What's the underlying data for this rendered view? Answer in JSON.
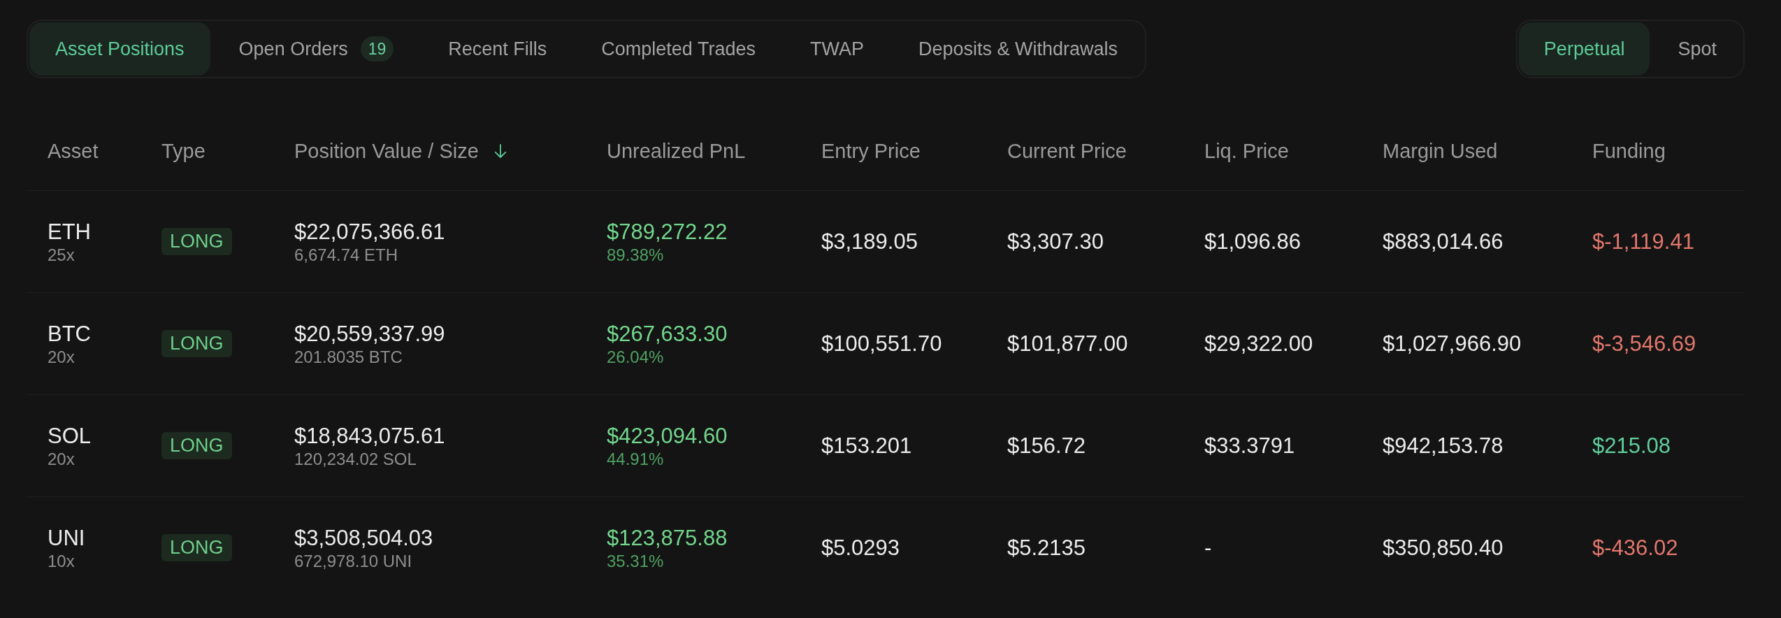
{
  "position_tabs": [
    {
      "label": "Asset Positions",
      "selected": true
    },
    {
      "label": "Open Orders",
      "count": "19",
      "selected": false
    },
    {
      "label": "Recent Fills",
      "selected": false
    },
    {
      "label": "Completed Trades",
      "selected": false
    },
    {
      "label": "TWAP",
      "selected": false
    },
    {
      "label": "Deposits & Withdrawals",
      "selected": false
    }
  ],
  "market_toggle": [
    {
      "label": "Perpetual",
      "selected": true
    },
    {
      "label": "Spot",
      "selected": false
    }
  ],
  "table": {
    "columns": [
      {
        "label": "Asset",
        "sorted": false
      },
      {
        "label": "Type",
        "sorted": false
      },
      {
        "label": "Position Value / Size",
        "sorted": true
      },
      {
        "label": "Unrealized PnL",
        "sorted": false
      },
      {
        "label": "Entry Price",
        "sorted": false
      },
      {
        "label": "Current Price",
        "sorted": false
      },
      {
        "label": "Liq. Price",
        "sorted": false
      },
      {
        "label": "Margin Used",
        "sorted": false
      },
      {
        "label": "Funding",
        "sorted": false
      }
    ],
    "rows": [
      {
        "asset": "ETH",
        "leverage": "25x",
        "type": "LONG",
        "position_value": "$22,075,366.61",
        "size": "6,674.74 ETH",
        "pnl": "$789,272.22",
        "pnl_percent": "89.38%",
        "entry_price": "$3,189.05",
        "current_price": "$3,307.30",
        "liq_price": "$1,096.86",
        "margin_used": "$883,014.66",
        "funding": {
          "amount": "$-1,119.41",
          "color": "#e2776d"
        }
      },
      {
        "asset": "BTC",
        "leverage": "20x",
        "type": "LONG",
        "position_value": "$20,559,337.99",
        "size": "201.8035 BTC",
        "pnl": "$267,633.30",
        "pnl_percent": "26.04%",
        "entry_price": "$100,551.70",
        "current_price": "$101,877.00",
        "liq_price": "$29,322.00",
        "margin_used": "$1,027,966.90",
        "funding": {
          "amount": "$-3,546.69",
          "color": "#e2776d"
        }
      },
      {
        "asset": "SOL",
        "leverage": "20x",
        "type": "LONG",
        "position_value": "$18,843,075.61",
        "size": "120,234.02 SOL",
        "pnl": "$423,094.60",
        "pnl_percent": "44.91%",
        "entry_price": "$153.201",
        "current_price": "$156.72",
        "liq_price": "$33.3791",
        "margin_used": "$942,153.78",
        "funding": {
          "amount": "$215.08",
          "color": "#5fcf9c"
        }
      },
      {
        "asset": "UNI",
        "leverage": "10x",
        "type": "LONG",
        "position_value": "$3,508,504.03",
        "size": "672,978.10 UNI",
        "pnl": "$123,875.88",
        "pnl_percent": "35.31%",
        "entry_price": "$5.0293",
        "current_price": "$5.2135",
        "liq_price": "-",
        "margin_used": "$350,850.40",
        "funding": {
          "amount": "$-436.02",
          "color": "#e2776d"
        }
      }
    ]
  }
}
